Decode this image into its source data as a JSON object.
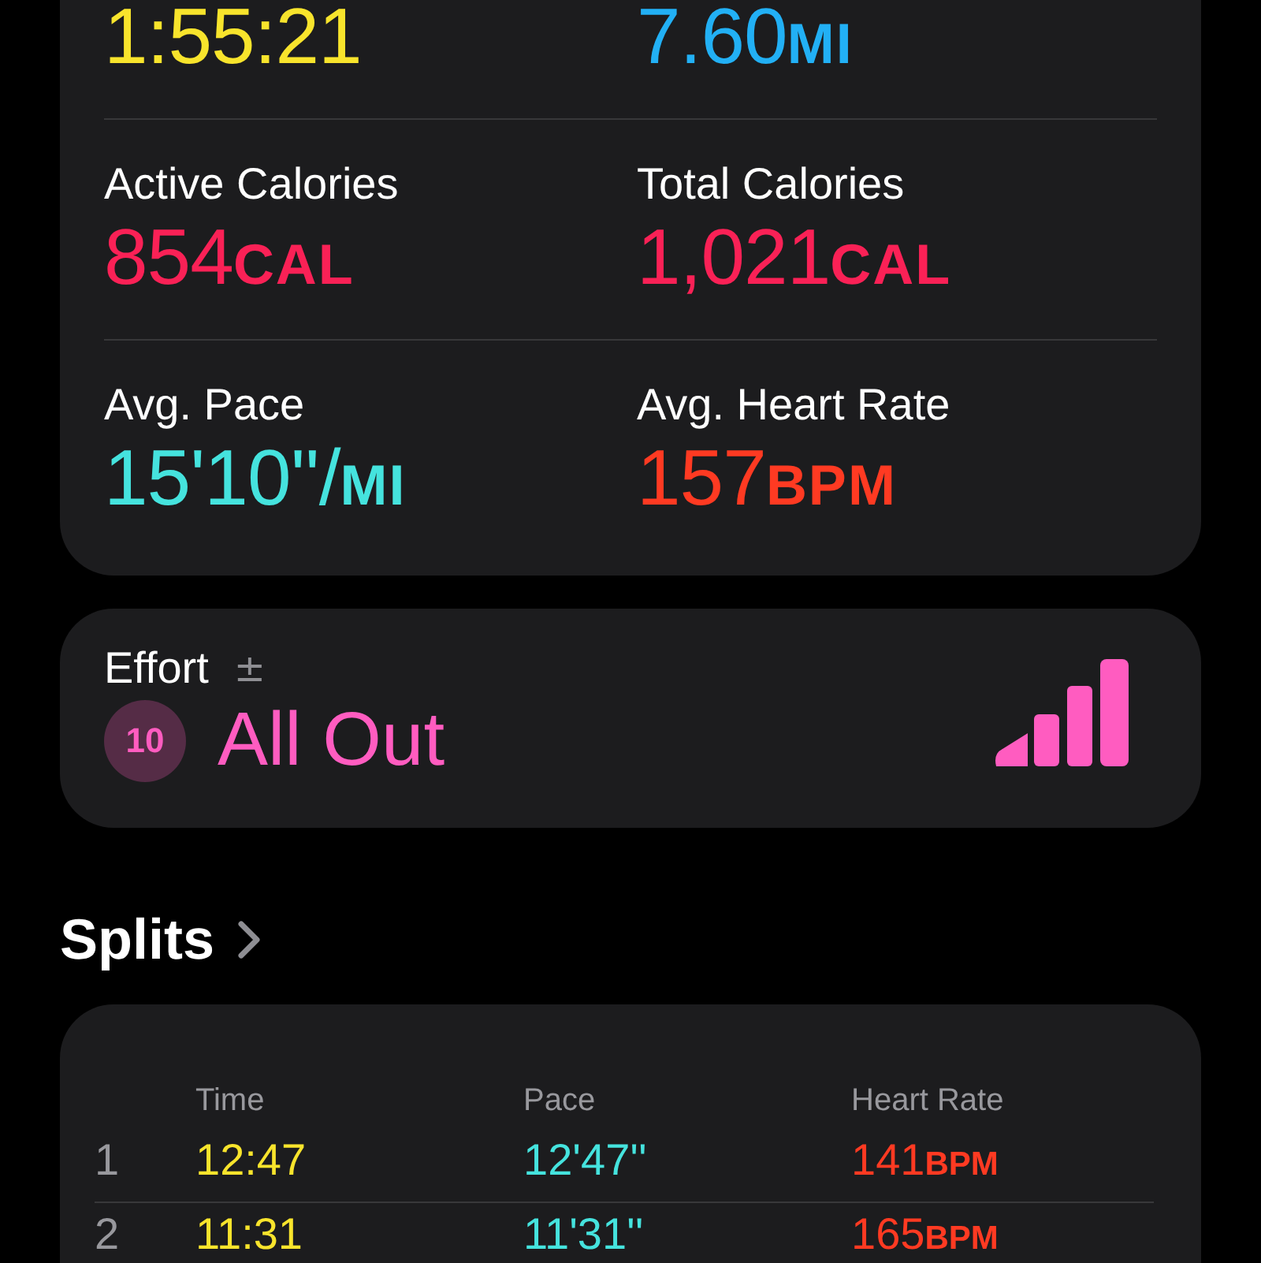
{
  "summary": {
    "rows": [
      [
        {
          "value": "1:55:21",
          "color": "#f8e42c"
        },
        {
          "value": "7.60",
          "unit": "MI",
          "color": "#22b0f5"
        }
      ],
      [
        {
          "label": "Active Calories",
          "value": "854",
          "unit": "CAL",
          "color": "#fa2156"
        },
        {
          "label": "Total Calories",
          "value": "1,021",
          "unit": "CAL",
          "color": "#fa2156"
        }
      ],
      [
        {
          "label": "Avg. Pace",
          "value": "15'10''/",
          "unit": "MI",
          "color": "#45e3de"
        },
        {
          "label": "Avg. Heart Rate",
          "value": "157",
          "unit": "BPM",
          "color": "#ff3a22"
        }
      ]
    ]
  },
  "effort": {
    "label": "Effort",
    "adjust_glyph": "±",
    "score": "10",
    "rating": "All Out",
    "color": "#ff5cc0"
  },
  "splits": {
    "title": "Splits",
    "columns": [
      {
        "label": "Time",
        "color": "#f8e42c"
      },
      {
        "label": "Pace",
        "color": "#45e3de"
      },
      {
        "label": "Heart Rate",
        "color": "#ff3a22"
      }
    ],
    "rows": [
      {
        "index": "1",
        "cells": [
          {
            "value": "12:47"
          },
          {
            "value": "12'47''"
          },
          {
            "value": "141",
            "unit": "BPM"
          }
        ]
      },
      {
        "index": "2",
        "cells": [
          {
            "value": "11:31"
          },
          {
            "value": "11'31''"
          },
          {
            "value": "165",
            "unit": "BPM"
          }
        ]
      }
    ]
  }
}
